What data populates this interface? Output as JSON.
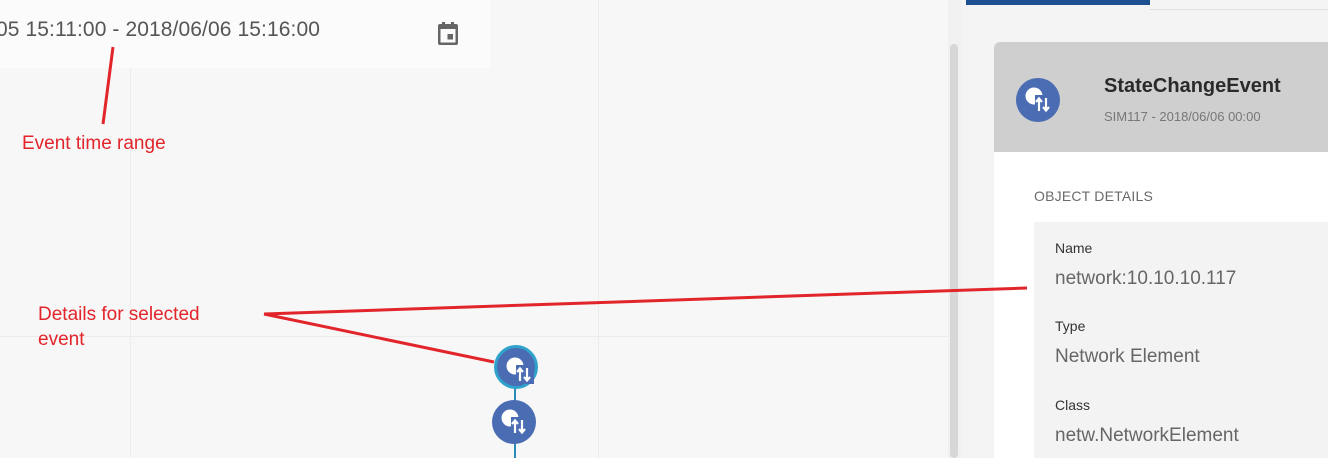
{
  "timeline": {
    "time_range": "05 15:11:00 - 2018/06/06 15:16:00",
    "calendar_icon": "calendar-icon"
  },
  "annotations": {
    "time_range_label": "Event time range",
    "details_label_line1": "Details for selected",
    "details_label_line2": "event",
    "color": "#e2252b"
  },
  "event_node": {
    "icon": "state-change-icon",
    "color": "#4a6cb3",
    "selected_border": "#2fa3cc"
  },
  "details": {
    "title": "StateChangeEvent",
    "subtitle": "SIM117 - 2018/06/06 00:00",
    "section_heading": "OBJECT DETAILS",
    "fields": [
      {
        "label": "Name",
        "value": "network:10.10.10.117"
      },
      {
        "label": "Type",
        "value": "Network Element"
      },
      {
        "label": "Class",
        "value": "netw.NetworkElement"
      }
    ],
    "tab_accent": "#1d4f91"
  }
}
